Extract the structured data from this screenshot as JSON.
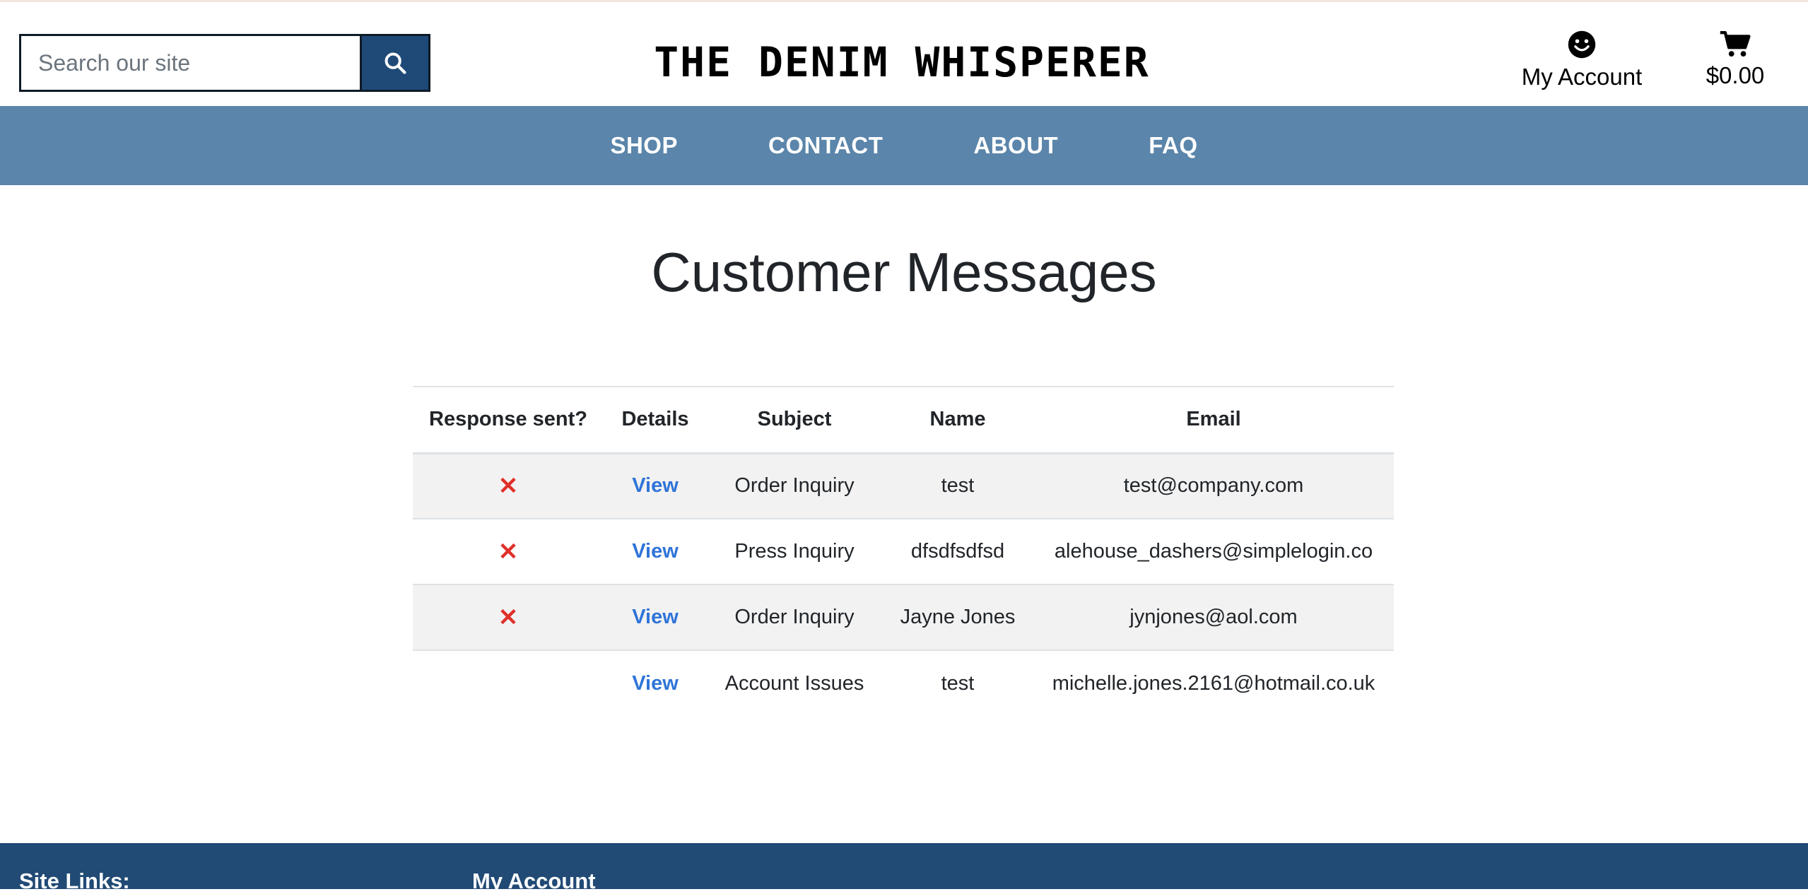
{
  "header": {
    "search_placeholder": "Search our site",
    "logo_text": "THE DENIM WHISPERER",
    "account_label": "My Account",
    "cart_total": "$0.00"
  },
  "nav": {
    "items": [
      {
        "label": "SHOP"
      },
      {
        "label": "CONTACT"
      },
      {
        "label": "ABOUT"
      },
      {
        "label": "FAQ"
      }
    ]
  },
  "main": {
    "title": "Customer Messages",
    "table": {
      "headers": [
        "Response sent?",
        "Details",
        "Subject",
        "Name",
        "Email"
      ],
      "rows": [
        {
          "response": "✕",
          "details": "View",
          "subject": "Order Inquiry",
          "name": "test",
          "email": "test@company.com"
        },
        {
          "response": "✕",
          "details": "View",
          "subject": "Press Inquiry",
          "name": "dfsdfsdfsd",
          "email": "alehouse_dashers@simplelogin.co"
        },
        {
          "response": "✕",
          "details": "View",
          "subject": "Order Inquiry",
          "name": "Jayne Jones",
          "email": "jynjones@aol.com"
        },
        {
          "response": "",
          "details": "View",
          "subject": "Account Issues",
          "name": "test",
          "email": "michelle.jones.2161@hotmail.co.uk"
        }
      ]
    }
  },
  "footer": {
    "site_links_heading": "Site Links:",
    "account_heading": "My Account"
  },
  "colors": {
    "nav_bg": "#5b85aa",
    "footer_bg": "#214a75",
    "search_button_bg": "#1f4a78",
    "link_blue": "#2f74d8",
    "x_red": "#e0302a"
  },
  "icons": {
    "search": "search-icon",
    "account": "smiley-icon",
    "cart": "cart-icon",
    "not_sent": "x-mark-icon"
  }
}
